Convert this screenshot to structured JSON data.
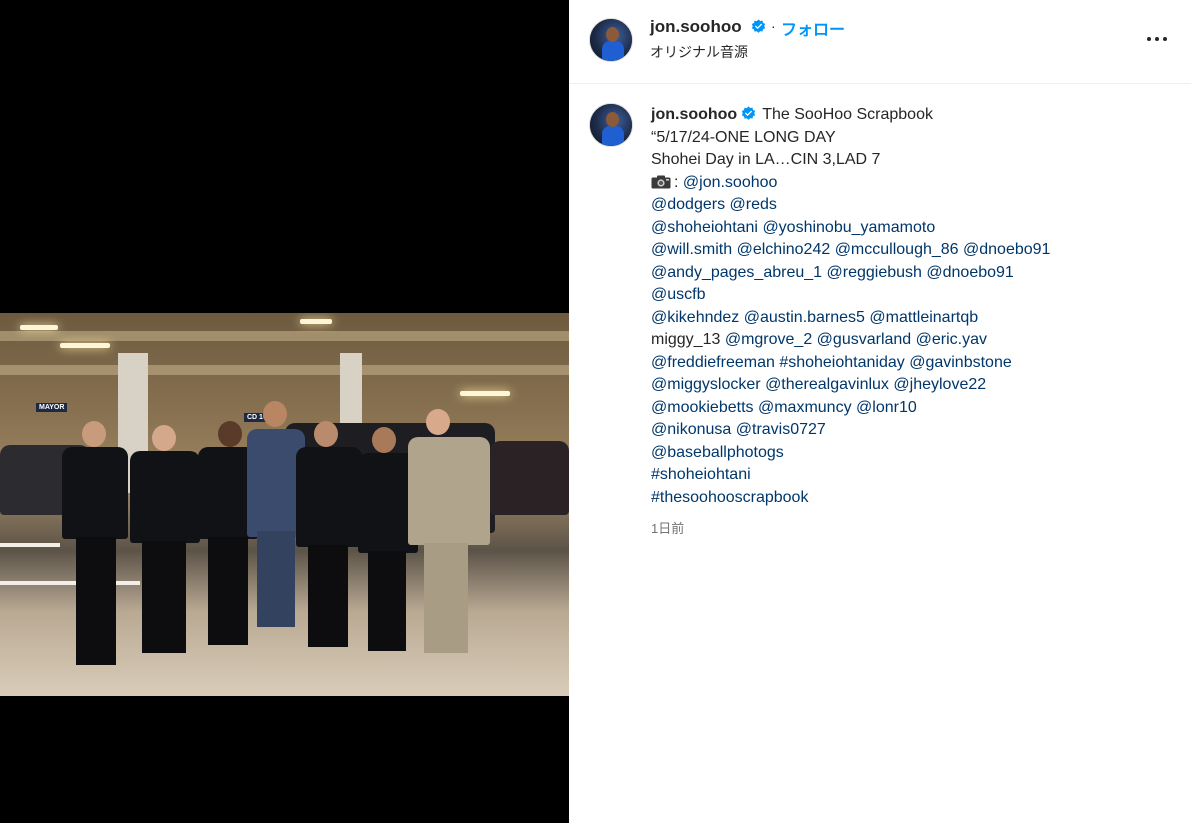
{
  "post": {
    "header": {
      "username": "jon.soohoo",
      "separator": "·",
      "follow_label": "フォロー",
      "audio_label": "オリジナル音源",
      "more_icon": "more-options-icon"
    },
    "caption": {
      "username": "jon.soohoo",
      "display_name": "The SooHoo Scrapbook",
      "lines": [
        [
          {
            "t": "“5/17/24-ONE LONG DAY",
            "link": false
          }
        ],
        [
          {
            "t": "Shohei Day in LA…CIN 3,LAD 7",
            "link": false
          }
        ],
        [
          {
            "t": "CAMERA",
            "link": false
          },
          {
            "t": ": ",
            "link": false
          },
          {
            "t": "@jon.soohoo",
            "link": true
          }
        ],
        [
          {
            "t": "@dodgers",
            "link": true
          },
          {
            "t": " ",
            "link": false
          },
          {
            "t": "@reds",
            "link": true
          }
        ],
        [
          {
            "t": "@shoheiohtani",
            "link": true
          },
          {
            "t": " ",
            "link": false
          },
          {
            "t": "@yoshinobu_yamamoto",
            "link": true
          }
        ],
        [
          {
            "t": "@will.smith",
            "link": true
          },
          {
            "t": " ",
            "link": false
          },
          {
            "t": "@elchino242",
            "link": true
          },
          {
            "t": " ",
            "link": false
          },
          {
            "t": "@mccullough_86",
            "link": true
          },
          {
            "t": " ",
            "link": false
          },
          {
            "t": "@dnoebo91",
            "link": true
          }
        ],
        [
          {
            "t": "@andy_pages_abreu_1",
            "link": true
          },
          {
            "t": " ",
            "link": false
          },
          {
            "t": "@reggiebush",
            "link": true
          },
          {
            "t": " ",
            "link": false
          },
          {
            "t": "@dnoebo91",
            "link": true
          }
        ],
        [
          {
            "t": "@uscfb",
            "link": true
          }
        ],
        [
          {
            "t": "@kikehndez",
            "link": true
          },
          {
            "t": " ",
            "link": false
          },
          {
            "t": "@austin.barnes5",
            "link": true
          },
          {
            "t": " ",
            "link": false
          },
          {
            "t": "@mattleinartqb",
            "link": true
          }
        ],
        [
          {
            "t": "miggy_13 ",
            "link": false
          },
          {
            "t": "@mgrove_2",
            "link": true
          },
          {
            "t": " ",
            "link": false
          },
          {
            "t": "@gusvarland",
            "link": true
          },
          {
            "t": " ",
            "link": false
          },
          {
            "t": "@eric.yav",
            "link": true
          }
        ],
        [
          {
            "t": "@freddiefreeman",
            "link": true
          },
          {
            "t": " ",
            "link": false
          },
          {
            "t": "#shoheiohtaniday",
            "link": true
          },
          {
            "t": " ",
            "link": false
          },
          {
            "t": "@gavinbstone",
            "link": true
          }
        ],
        [
          {
            "t": "@miggyslocker",
            "link": true
          },
          {
            "t": " ",
            "link": false
          },
          {
            "t": "@therealgavinlux",
            "link": true
          },
          {
            "t": " ",
            "link": false
          },
          {
            "t": "@jheylove22",
            "link": true
          }
        ],
        [
          {
            "t": "@mookiebetts",
            "link": true
          },
          {
            "t": " ",
            "link": false
          },
          {
            "t": "@maxmuncy",
            "link": true
          },
          {
            "t": " ",
            "link": false
          },
          {
            "t": "@lonr10",
            "link": true
          }
        ],
        [
          {
            "t": "@nikonusa",
            "link": true
          },
          {
            "t": " ",
            "link": false
          },
          {
            "t": "@travis0727",
            "link": true
          }
        ],
        [
          {
            "t": "@baseballphotogs",
            "link": true
          }
        ],
        [
          {
            "t": "#shoheiohtani",
            "link": true
          }
        ],
        [
          {
            "t": "#thesoohooscrapbook",
            "link": true
          }
        ]
      ],
      "timestamp": "1日前"
    },
    "photo": {
      "sign_mayor": "MAYOR",
      "sign_cd": "CD 10"
    },
    "colors": {
      "link": "#00376b",
      "follow": "#0095f6",
      "verified": "#0095f6",
      "text": "#262626",
      "muted": "#737373"
    }
  }
}
